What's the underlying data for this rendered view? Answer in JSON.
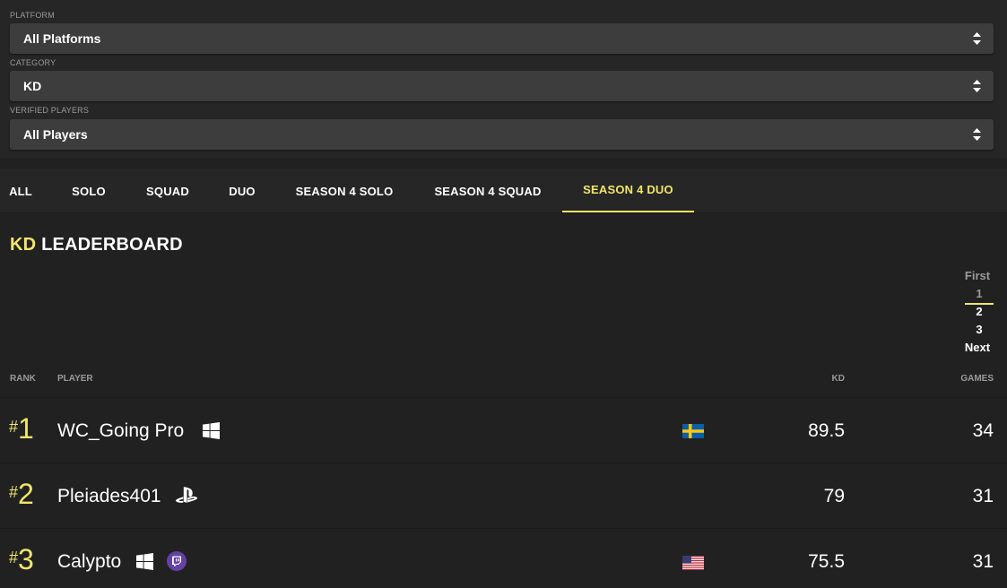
{
  "filters": {
    "platform": {
      "label": "PLATFORM",
      "value": "All Platforms"
    },
    "category": {
      "label": "CATEGORY",
      "value": "KD"
    },
    "verified": {
      "label": "VERIFIED PLAYERS",
      "value": "All Players"
    }
  },
  "tabs": [
    "ALL",
    "SOLO",
    "SQUAD",
    "DUO",
    "SEASON 4 SOLO",
    "SEASON 4 SQUAD",
    "SEASON 4 DUO"
  ],
  "active_tab": "SEASON 4 DUO",
  "leaderboard": {
    "title_accent": "KD",
    "title_rest": "LEADERBOARD"
  },
  "pager": {
    "first": "First",
    "pages": [
      "1",
      "2",
      "3"
    ],
    "next": "Next",
    "current": "1"
  },
  "table": {
    "headers": {
      "rank": "RANK",
      "player": "PLAYER",
      "kd": "KD",
      "games": "GAMES"
    },
    "rows": [
      {
        "rank_symbol": "#",
        "rank": "1",
        "player": "WC_Going Pro",
        "platform_icons": [
          "windows-icon"
        ],
        "flag": "sweden-flag",
        "kd": "89.5",
        "games": "34"
      },
      {
        "rank_symbol": "#",
        "rank": "2",
        "player": "Pleiades401",
        "platform_icons": [
          "playstation-icon"
        ],
        "flag": "",
        "kd": "79",
        "games": "31"
      },
      {
        "rank_symbol": "#",
        "rank": "3",
        "player": "Calypto",
        "platform_icons": [
          "windows-icon",
          "twitch-icon"
        ],
        "flag": "usa-flag",
        "kd": "75.5",
        "games": "31"
      }
    ]
  },
  "colors": {
    "accent": "#f1e66a",
    "background": "#212121",
    "select_bg": "#3d3d3d",
    "twitch": "#6441a5"
  }
}
